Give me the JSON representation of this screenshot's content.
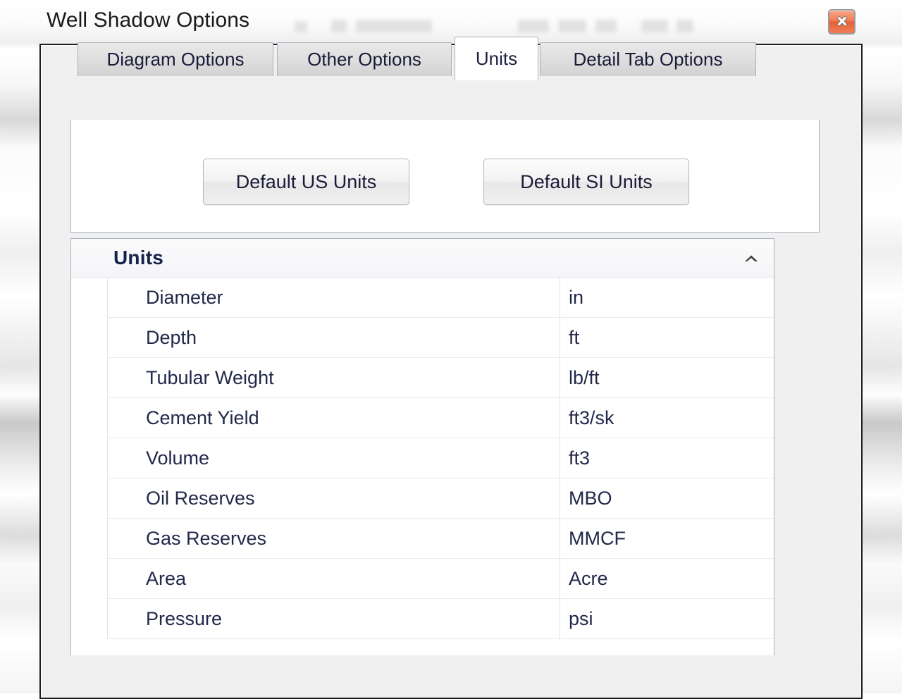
{
  "window": {
    "title": "Well Shadow Options",
    "close_icon": "close-x-icon"
  },
  "tabs": [
    {
      "label": "Diagram Options",
      "active": false
    },
    {
      "label": "Other Options",
      "active": false
    },
    {
      "label": "Units",
      "active": true
    },
    {
      "label": "Detail Tab Options",
      "active": false
    }
  ],
  "toolbar": {
    "default_us_label": "Default US Units",
    "default_si_label": "Default SI Units"
  },
  "grid": {
    "group_title": "Units",
    "collapse_icon": "chevron-up-icon",
    "rows": [
      {
        "label": "Diameter",
        "value": "in"
      },
      {
        "label": "Depth",
        "value": "ft"
      },
      {
        "label": "Tubular Weight",
        "value": "lb/ft"
      },
      {
        "label": "Cement Yield",
        "value": "ft3/sk"
      },
      {
        "label": "Volume",
        "value": "ft3"
      },
      {
        "label": "Oil Reserves",
        "value": "MBO"
      },
      {
        "label": "Gas Reserves",
        "value": "MMCF"
      },
      {
        "label": "Area",
        "value": "Acre"
      },
      {
        "label": "Pressure",
        "value": "psi"
      }
    ]
  },
  "colors": {
    "close_button": "#e4603a",
    "dialog_border": "#1d1d1d",
    "tab_border": "#a9b2bd",
    "text": "#22284a"
  }
}
